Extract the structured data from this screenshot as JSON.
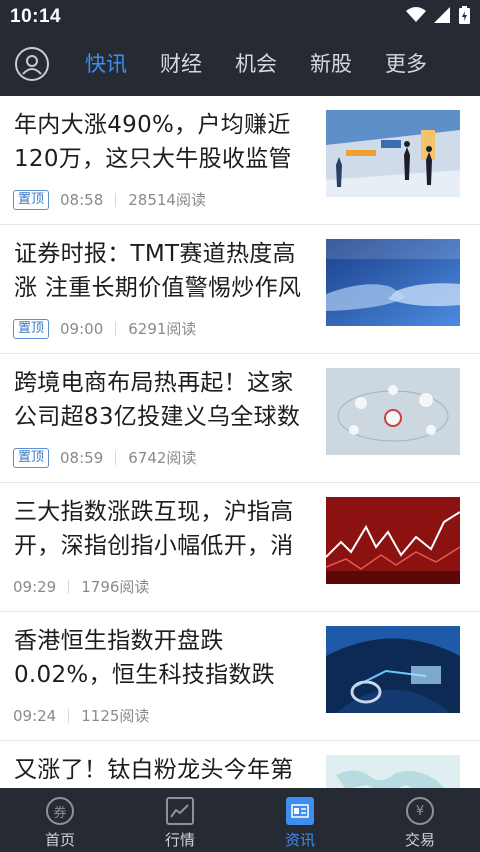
{
  "status_bar": {
    "time": "10:14",
    "icons": [
      "wifi-icon",
      "signal-icon",
      "battery-icon"
    ]
  },
  "header": {
    "avatar_icon": "user-icon",
    "tabs": [
      {
        "label": "快讯",
        "active": true
      },
      {
        "label": "财经",
        "active": false
      },
      {
        "label": "机会",
        "active": false
      },
      {
        "label": "新股",
        "active": false
      },
      {
        "label": "更多",
        "active": false
      }
    ]
  },
  "articles": [
    {
      "title": "年内大涨490%，户均赚近120万，这只大牛股收监管",
      "badge": "置顶",
      "time": "08:58",
      "reads": "28514阅读"
    },
    {
      "title": "证券时报：TMT赛道热度高涨 注重长期价值警惕炒作风",
      "badge": "置顶",
      "time": "09:00",
      "reads": "6291阅读"
    },
    {
      "title": "跨境电商布局热再起！这家公司超83亿投建义乌全球数",
      "badge": "置顶",
      "time": "08:59",
      "reads": "6742阅读"
    },
    {
      "title": "三大指数涨跌互现，沪指高开，深指创指小幅低开，消",
      "badge": "",
      "time": "09:29",
      "reads": "1796阅读"
    },
    {
      "title": "香港恒生指数开盘跌0.02%，恒生科技指数跌",
      "badge": "",
      "time": "09:24",
      "reads": "1125阅读"
    },
    {
      "title": "又涨了！钛白粉龙头今年第",
      "badge": "",
      "time": "",
      "reads": ""
    }
  ],
  "tabbar": [
    {
      "label": "首页",
      "icon": "home-coupon-icon",
      "glyph": "券",
      "active": false
    },
    {
      "label": "行情",
      "icon": "market-chart-icon",
      "glyph": "",
      "active": false
    },
    {
      "label": "资讯",
      "icon": "news-icon",
      "glyph": "",
      "active": true
    },
    {
      "label": "交易",
      "icon": "trade-yen-icon",
      "glyph": "¥",
      "active": false
    }
  ],
  "colors": {
    "bar_bg": "#262a33",
    "accent": "#3d8ef0",
    "badge_border": "#5a8fd0"
  }
}
